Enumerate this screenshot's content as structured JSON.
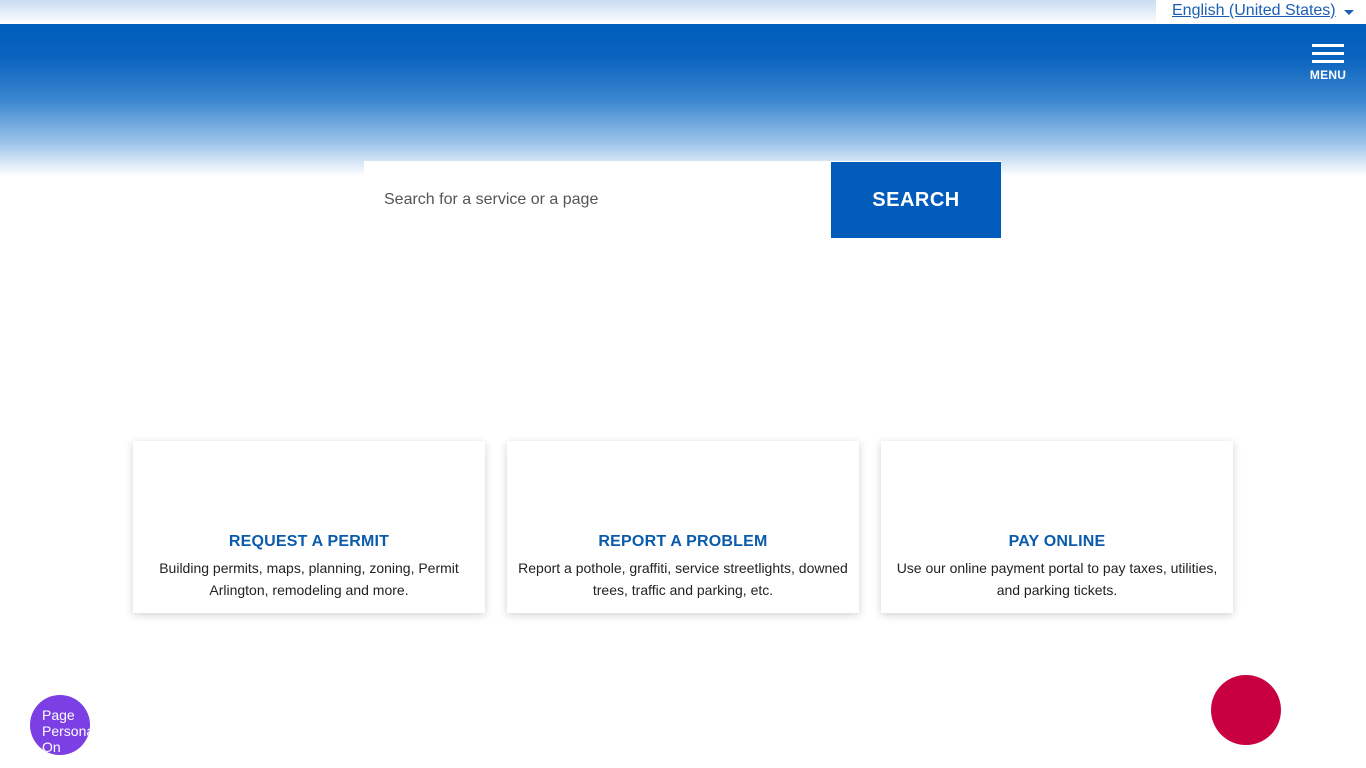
{
  "language_selector": {
    "label": "English (United States)"
  },
  "header": {
    "menu_label": "MENU"
  },
  "search": {
    "placeholder": "Search for a service or a page",
    "button_label": "SEARCH"
  },
  "cards": [
    {
      "title": "REQUEST A PERMIT",
      "description": "Building permits, maps, planning, zoning, Permit Arlington, remodeling and more."
    },
    {
      "title": "REPORT A PROBLEM",
      "description": "Report a pothole, graffiti, service streetlights, downed trees, traffic and parking, etc."
    },
    {
      "title": "PAY ONLINE",
      "description": "Use our online payment portal to pay taxes, utilities, and parking tickets."
    }
  ],
  "personalization": {
    "alt_text": "Page Personal On"
  },
  "colors": {
    "brand_blue": "#005bbb",
    "link_blue": "#1a5fb4",
    "chat_red": "#c8003f",
    "persona_purple": "#7b3fe4"
  }
}
